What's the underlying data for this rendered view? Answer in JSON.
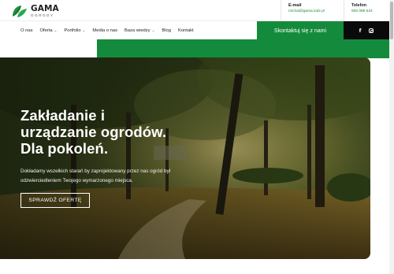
{
  "header": {
    "logo": {
      "title": "GAMA",
      "subtitle": "OGRODY"
    },
    "email": {
      "label": "E-mail",
      "value": "michal@gama.lodz.pl"
    },
    "phone": {
      "label": "Telefon",
      "value": "506 089 524"
    }
  },
  "nav": {
    "items": [
      {
        "label": "O nas",
        "dropdown": false
      },
      {
        "label": "Oferta",
        "dropdown": true
      },
      {
        "label": "Portfolio",
        "dropdown": true
      },
      {
        "label": "Media o nas",
        "dropdown": false
      },
      {
        "label": "Baza wiedzy",
        "dropdown": true
      },
      {
        "label": "Blog",
        "dropdown": false
      },
      {
        "label": "Kontakt",
        "dropdown": false
      }
    ],
    "cta_label": "Skontaktuj się z nami",
    "social": [
      "facebook-icon",
      "instagram-icon"
    ]
  },
  "hero": {
    "title_lines": [
      "Zakładanie i",
      "urządzanie ogrodów.",
      "Dla pokoleń."
    ],
    "text_lines": [
      "Dokładamy wszelkich starań by zaprojektowany przez nas ogród był",
      "odzwierciedleniem Twojego wymarzonego miejsca."
    ],
    "button_label": "SPRAWDŹ OFERTĘ"
  },
  "colors": {
    "accent": "#148b3c",
    "dark": "#0a0a0a"
  }
}
